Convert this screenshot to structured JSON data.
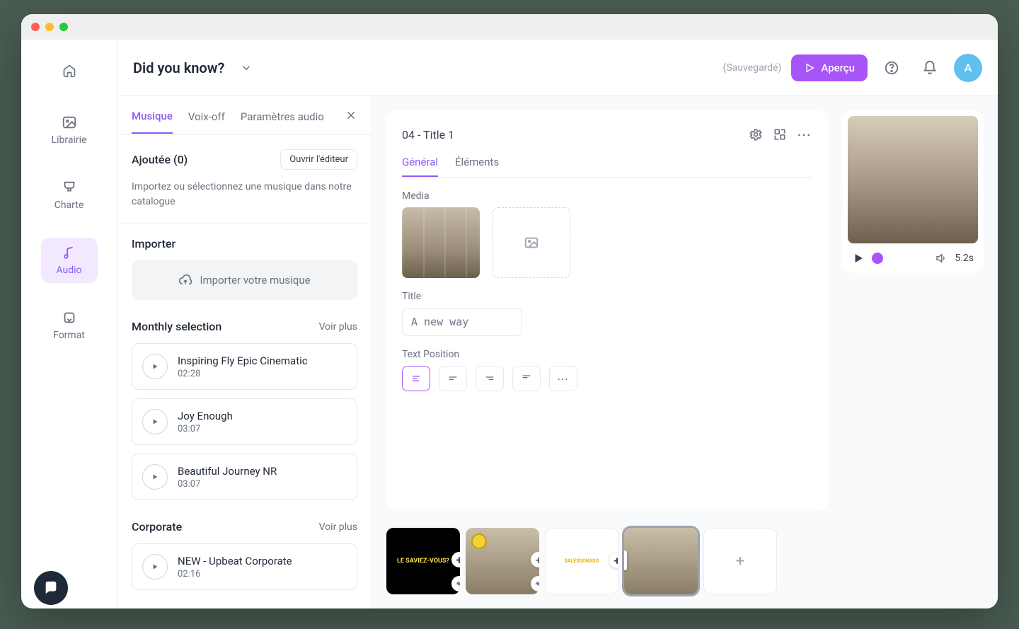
{
  "header": {
    "title": "Did you know?",
    "saved": "(Sauvegardé)",
    "preview": "Aperçu",
    "avatar": "A"
  },
  "nav": {
    "librairie": "Librairie",
    "charte": "Charte",
    "audio": "Audio",
    "format": "Format"
  },
  "panel": {
    "tabs": {
      "musique": "Musique",
      "voixoff": "Voix-off",
      "params": "Paramètres audio"
    },
    "added": {
      "title": "Ajoutée (0)",
      "open": "Ouvrir l'éditeur",
      "help": "Importez ou sélectionnez une musique dans notre catalogue"
    },
    "import": {
      "title": "Importer",
      "button": "Importer votre musique"
    },
    "monthly": {
      "title": "Monthly selection",
      "more": "Voir plus",
      "tracks": [
        {
          "name": "Inspiring Fly Epic Cinematic",
          "dur": "02:28"
        },
        {
          "name": "Joy Enough",
          "dur": "03:07"
        },
        {
          "name": "Beautiful Journey NR",
          "dur": "03:07"
        }
      ]
    },
    "corporate": {
      "title": "Corporate",
      "more": "Voir plus",
      "tracks": [
        {
          "name": "NEW - Upbeat Corporate",
          "dur": "02:16"
        }
      ]
    }
  },
  "editor": {
    "title": "04 - Title 1",
    "tabs": {
      "general": "Général",
      "elements": "Éléments"
    },
    "media_label": "Media",
    "title_label": "Title",
    "title_value": "A new way",
    "pos_label": "Text Position"
  },
  "preview": {
    "time": "5.2s"
  },
  "timeline": {
    "slide1": "LE SAVIEZ-VOUS?",
    "slide3": "SALESDORADO"
  }
}
